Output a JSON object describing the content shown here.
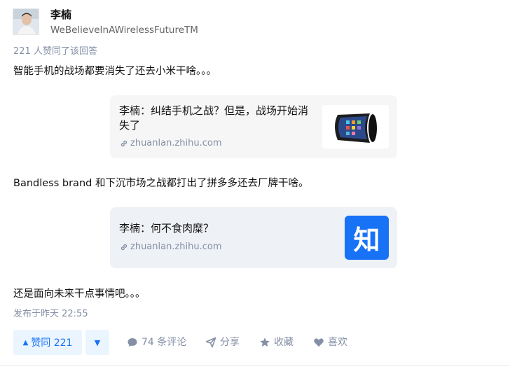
{
  "author": {
    "name": "李楠",
    "bio": "WeBelieveInAWirelessFutureTM"
  },
  "answer": {
    "votes_line": "221 人赞同了该回答",
    "paragraphs": [
      "智能手机的战场都要消失了还去小米干啥。。。",
      "Bandless brand 和下沉市场之战都打出了拼多多还去厂牌干啥。",
      "还是面向未来干点事情吧。。。"
    ],
    "cards": [
      {
        "title": "李楠：纠结手机之战？但是，战场开始消失了",
        "url": "zhuanlan.zhihu.com",
        "thumb": "flexible-phone-image"
      },
      {
        "title": "李楠：何不食肉糜？",
        "url": "zhuanlan.zhihu.com",
        "thumb_text": "知"
      }
    ],
    "published": "发布于昨天 22:55"
  },
  "actions": {
    "upvote_label": "赞同 221",
    "comments": "74 条评论",
    "share": "分享",
    "collect": "收藏",
    "like": "喜欢"
  },
  "colors": {
    "accent": "#1772f6",
    "accent_bg": "#ebf5ff",
    "meta_gray": "#8590a6"
  }
}
